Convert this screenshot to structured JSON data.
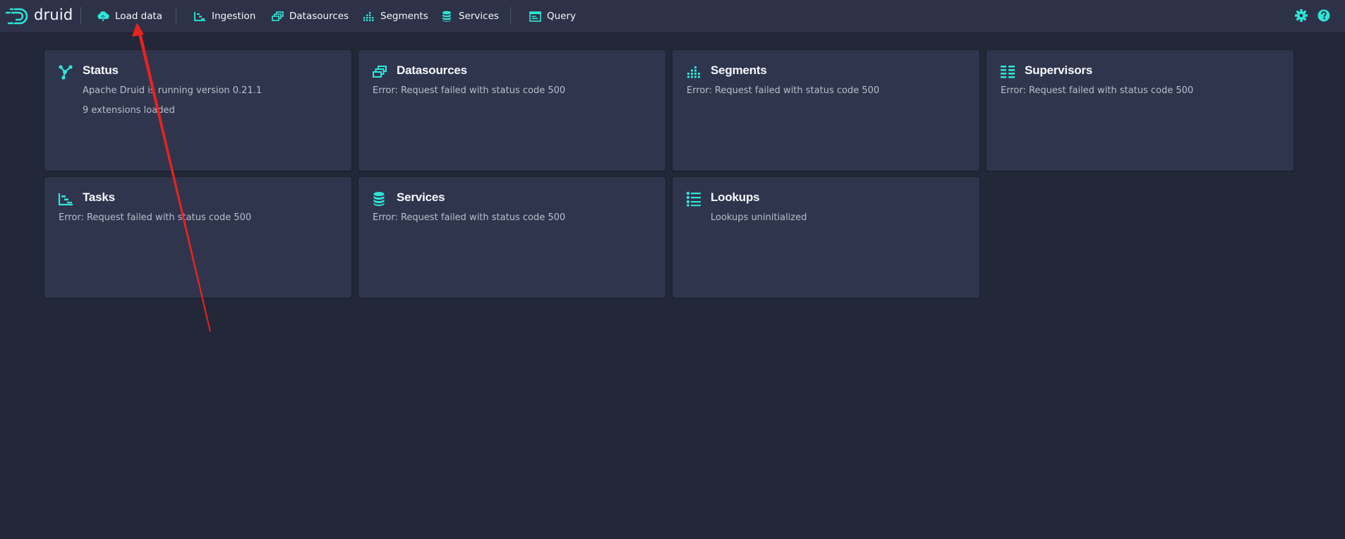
{
  "header": {
    "logo_text": "druid",
    "nav": {
      "load_data": "Load data",
      "ingestion": "Ingestion",
      "datasources": "Datasources",
      "segments": "Segments",
      "services": "Services",
      "query": "Query"
    },
    "icons": {
      "load_data": "cloud-upload-icon",
      "ingestion": "gantt-chart-icon",
      "datasources": "multi-select-icon",
      "segments": "stacked-chart-icon",
      "services": "database-icon",
      "query": "application-icon",
      "settings": "cog-icon",
      "help": "help-icon"
    }
  },
  "cards": {
    "status": {
      "title": "Status",
      "line1": "Apache Druid is running version 0.21.1",
      "line2": "9 extensions loaded"
    },
    "datasources": {
      "title": "Datasources",
      "line1": "Error: Request failed with status code 500"
    },
    "segments": {
      "title": "Segments",
      "line1": "Error: Request failed with status code 500"
    },
    "supervisors": {
      "title": "Supervisors",
      "line1": "Error: Request failed with status code 500"
    },
    "tasks": {
      "title": "Tasks",
      "line1": "Error: Request failed with status code 500"
    },
    "services": {
      "title": "Services",
      "line1": "Error: Request failed with status code 500"
    },
    "lookups": {
      "title": "Lookups",
      "line1": "Lookups uninitialized"
    }
  },
  "colors": {
    "accent": "#2ee6d6",
    "background": "#232839",
    "header": "#2d3249",
    "card": "#30354e",
    "annotation": "#e8231d"
  }
}
